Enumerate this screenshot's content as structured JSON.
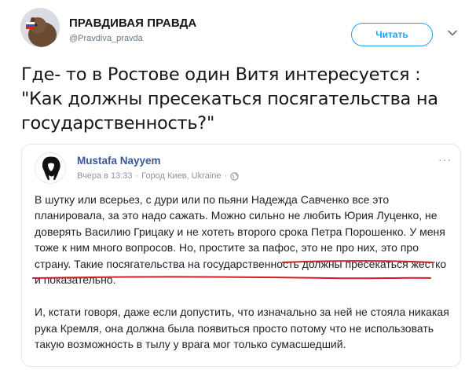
{
  "tweet": {
    "author_name": "ПРАВДИВАЯ ПРАВДА",
    "author_handle": "@Pravdiva_pravda",
    "follow_label": "Читать",
    "text": "Где- то в Ростове один Витя интересуется : \"Как должны пресекаться посягательства на государственность?\""
  },
  "embed": {
    "name": "Mustafa Nayyem",
    "time": "Вчера в 13:33",
    "separator": "·",
    "location": "Город Киев, Ukraine",
    "separator2": "·",
    "menu": "···",
    "paragraph1_part1": "В шутку или всерьез, с дури или по пьяни Надежда Савченко все это планировала, за это надо сажать. Можно сильно не любить Юрия Луценко, не доверять Василию Грицаку и не хотеть второго срока Петра Порошенко. У меня тоже к ним много вопросов. Но, простите за пафос, это не про них, это про страну. ",
    "paragraph1_highlight": "Такие посягательства на государственность должны пресекаться жестко и показательно.",
    "paragraph2": "И, кстати говоря, даже если допустить, что изначально за ней не стояла никакая рука Кремля, она должна была появиться просто потому что не использовать такую возможность в тылу у врага мог только сумасшедший."
  },
  "colors": {
    "accent": "#1da1f2",
    "fb_link": "#385898",
    "underline": "#d11f2a"
  },
  "icons": {
    "verified_avatar": "avatar-bear-flag",
    "chevron": "chevron-down-icon",
    "globe": "globe-icon"
  }
}
